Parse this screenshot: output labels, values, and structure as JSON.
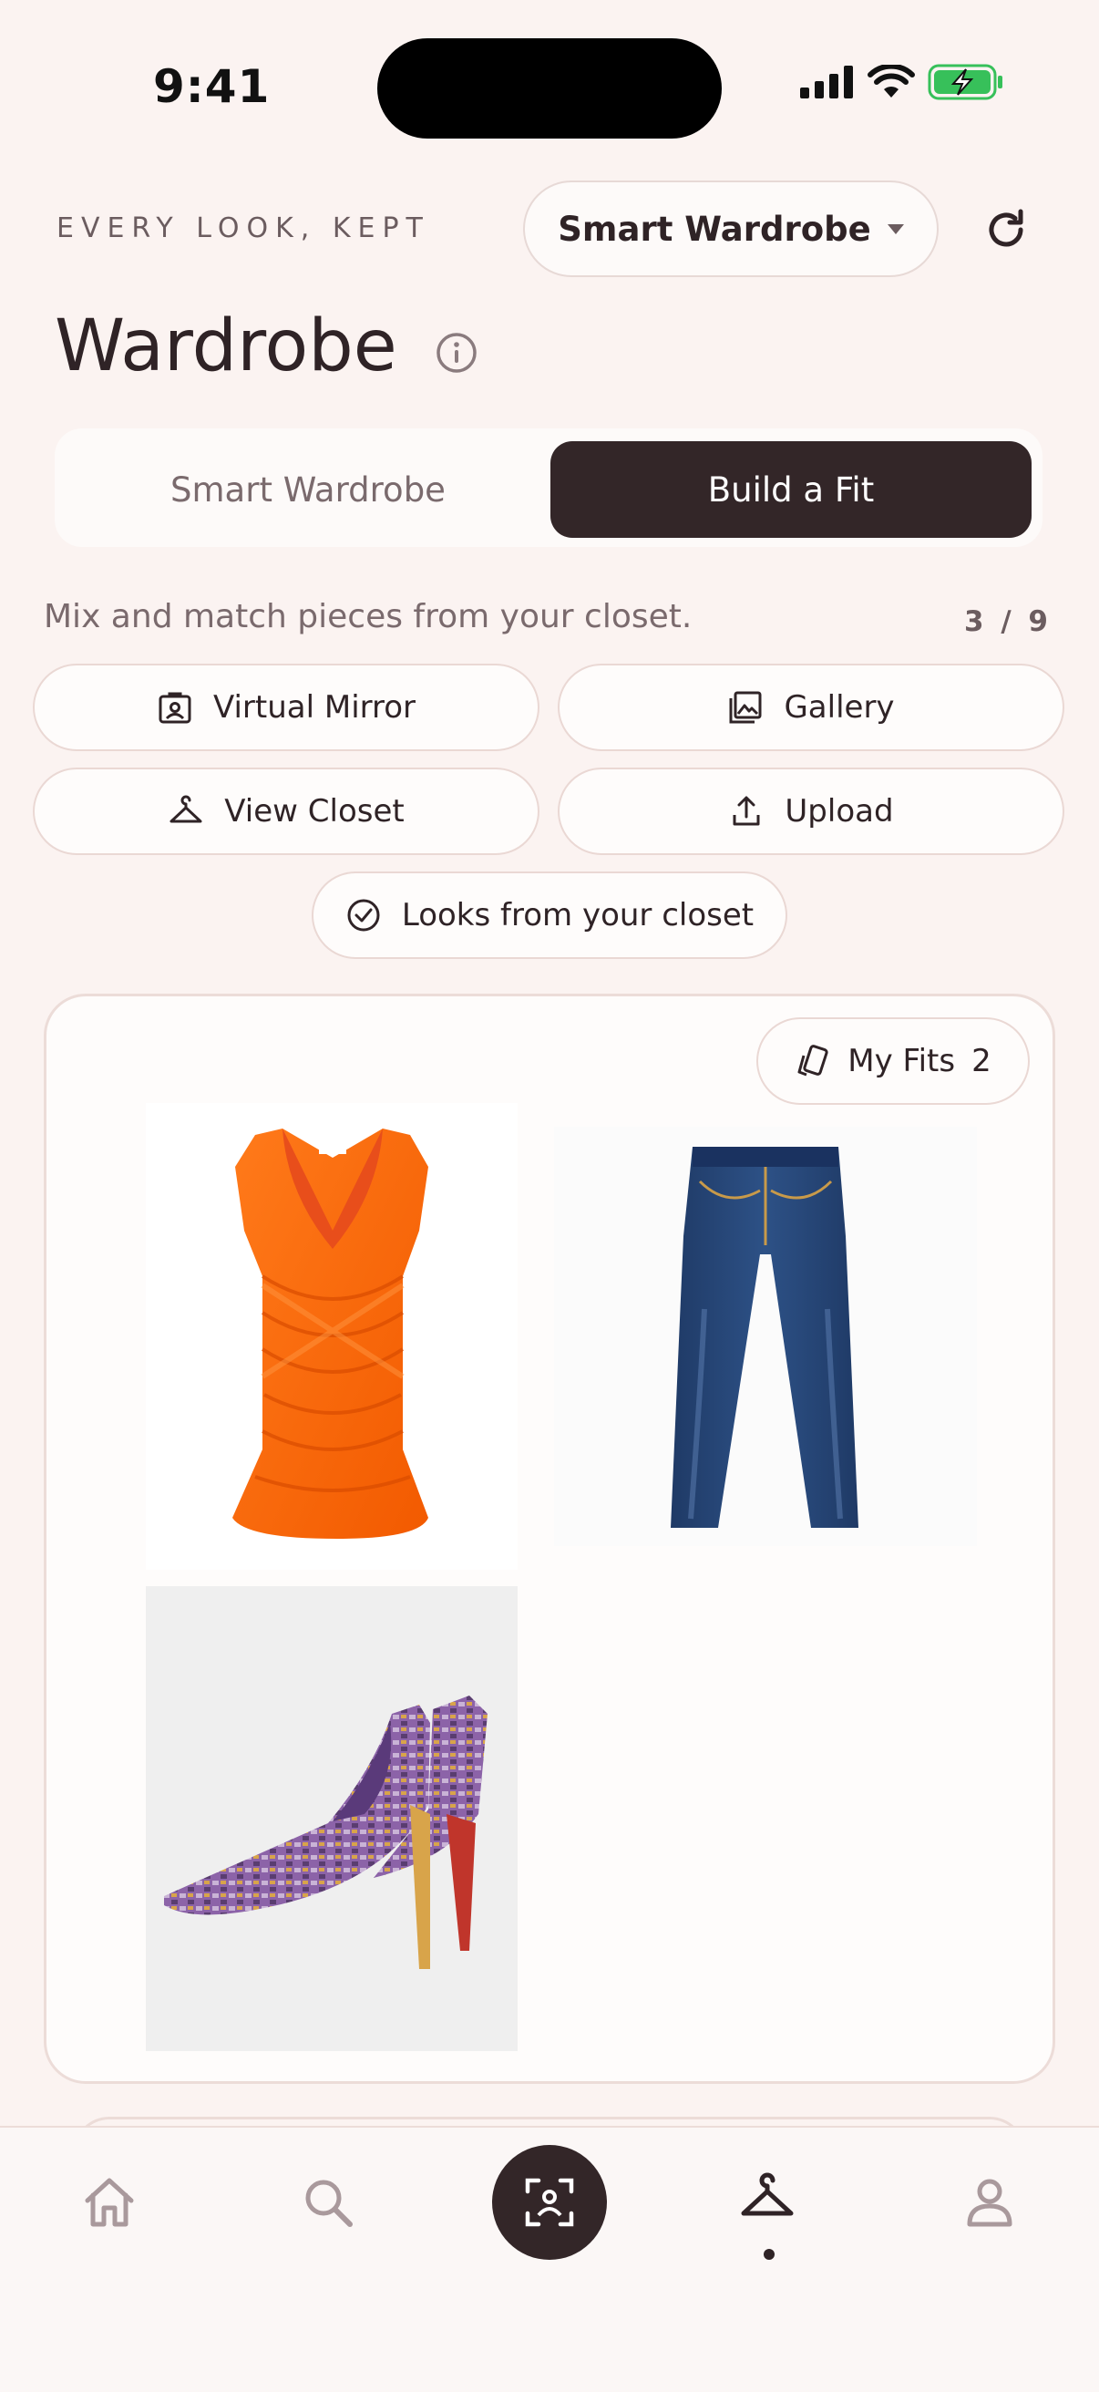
{
  "status_bar": {
    "time": "9:41"
  },
  "header": {
    "eyebrow": "EVERY LOOK, KEPT",
    "wardrobe_select": "Smart Wardrobe",
    "title": "Wardrobe"
  },
  "segmented": {
    "left": "Smart Wardrobe",
    "right": "Build a Fit",
    "active": "Build a Fit"
  },
  "subtitle": "Mix and match pieces from your closet.",
  "counter": "3 / 9",
  "actions": {
    "virtual_mirror": "Virtual Mirror",
    "gallery": "Gallery",
    "view_closet": "View Closet",
    "upload": "Upload",
    "looks": "Looks from your closet"
  },
  "fit_card": {
    "my_fits_label": "My Fits",
    "my_fits_count": "2",
    "items": [
      "orange-draped-top",
      "blue-skinny-jeans",
      "snakeskin-pumps"
    ]
  },
  "nav": {
    "items": [
      "home",
      "search",
      "scan",
      "wardrobe",
      "profile"
    ],
    "active": "wardrobe"
  },
  "colors": {
    "background": "#fbf3f1",
    "accent": "#332628",
    "muted": "#7a6a6d",
    "border": "#ead8d4"
  }
}
